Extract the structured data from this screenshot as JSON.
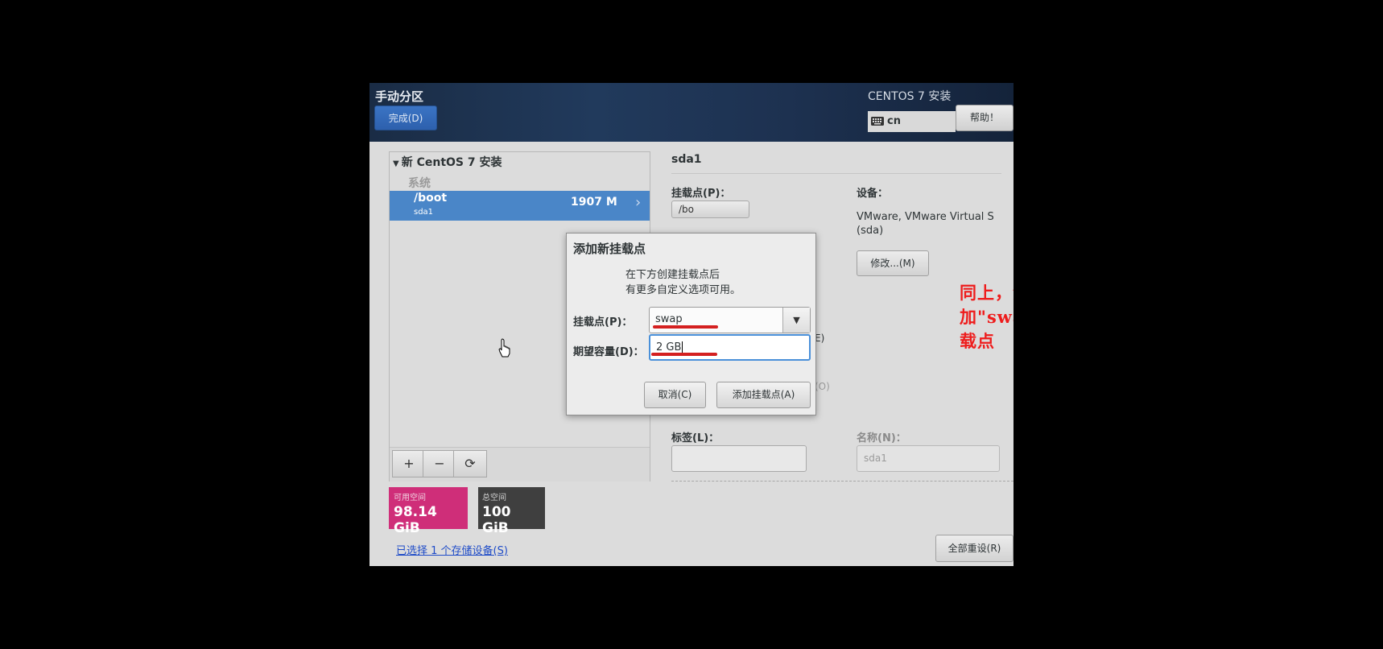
{
  "header": {
    "title": "手动分区",
    "done_label": "完成(D)",
    "product": "CENTOS 7 安装",
    "keyboard_layout": "cn",
    "help_label": "帮助！"
  },
  "partition_tree": {
    "install_title": "新 CentOS 7 安装",
    "group_label": "系统",
    "selected_partition": {
      "mount": "/boot",
      "device": "sda1",
      "size": "1907 M"
    },
    "toolbar": {
      "add": "+",
      "remove": "−",
      "refresh": "⟳"
    }
  },
  "space": {
    "available_label": "可用空间",
    "available_value": "98.14 GiB",
    "total_label": "总空间",
    "total_value": "100 GiB"
  },
  "storage_link": "已选择 1 个存储设备(S)",
  "details": {
    "title": "sda1",
    "mount_label": "挂载点(P)：",
    "mount_value": "/bo",
    "device_label": "设备：",
    "device_value": "VMware, VMware Virtual S (sda)",
    "modify_label": "修改...(M)",
    "frag1": "E)",
    "frag2": "(O)",
    "label_label": "标签(L)：",
    "label_value": "",
    "name_label": "名称(N)：",
    "name_value": "sda1",
    "reset_label": "全部重设(R)"
  },
  "dialog": {
    "title": "添加新挂载点",
    "desc_line1": "在下方创建挂载点后",
    "desc_line2": "有更多自定义选项可用。",
    "mount_label": "挂载点(P)：",
    "mount_value": "swap",
    "size_label": "期望容量(D)：",
    "size_value": "2 GB",
    "cancel_label": "取消(C)",
    "add_label": "添加挂载点(A)"
  },
  "annotation": "同上，添加\"swap\"挂载点",
  "colors": {
    "accent_blue": "#4a86c8",
    "available_magenta": "#cf2e79",
    "annotation_red": "#ee1c1c"
  }
}
